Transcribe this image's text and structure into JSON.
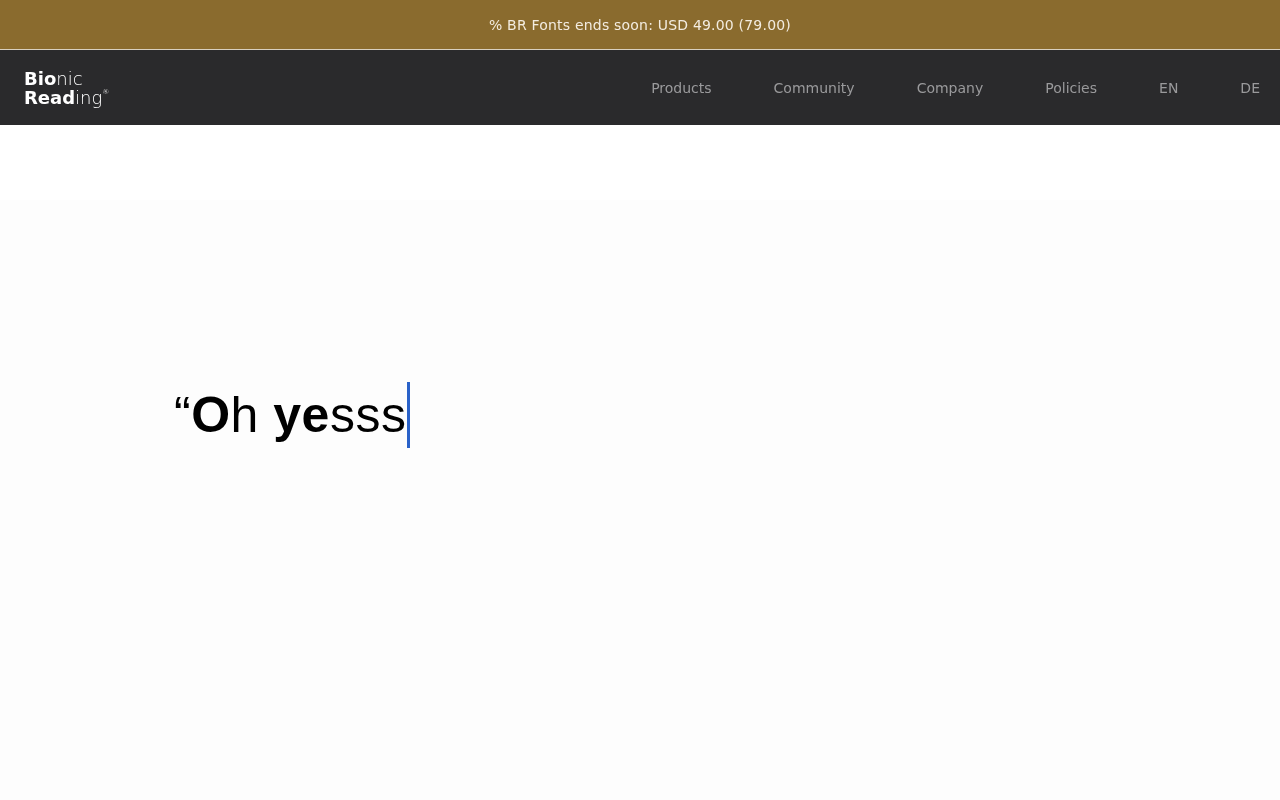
{
  "promo_banner": {
    "text": "% BR Fonts ends soon: USD 49.00 (79.00)"
  },
  "nav": {
    "logo_lines": [
      "**Bio**nic",
      "**Read**ing$^{®}$"
    ],
    "items": [
      "Products",
      "Community",
      "Company",
      "Policies",
      "EN",
      "DE"
    ]
  },
  "hero": {
    "headline": "“**O**h **ye**sss",
    "cursor": true
  }
}
